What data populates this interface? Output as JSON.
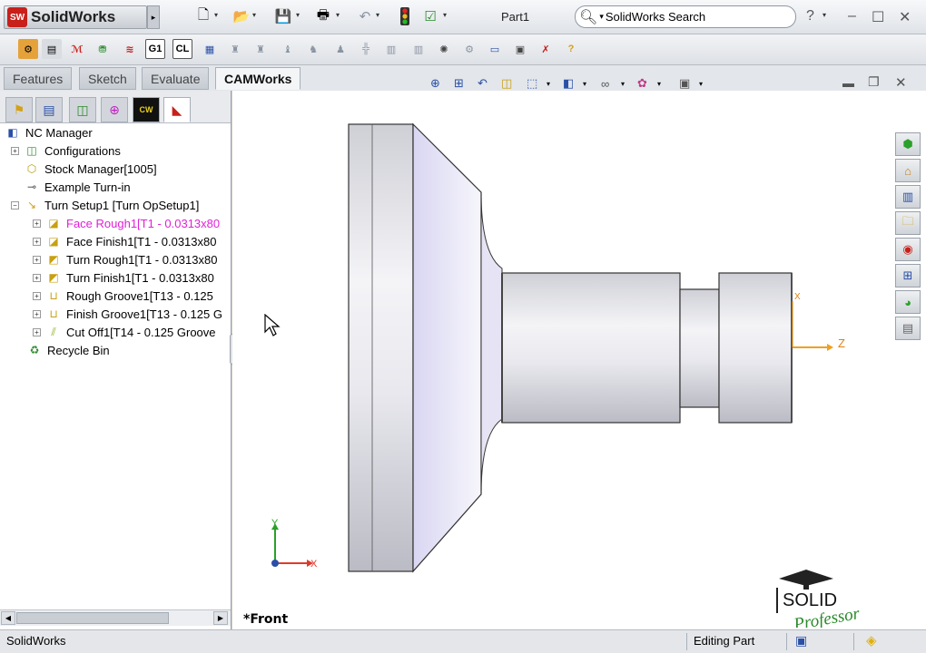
{
  "app": {
    "logo_badge": "SW",
    "name": "SolidWorks",
    "doc_title": "Part1"
  },
  "search": {
    "placeholder": "SolidWorks Search"
  },
  "window_buttons": [
    "?",
    "–",
    "☐",
    "✕"
  ],
  "top_tabs": [
    {
      "label": "Features"
    },
    {
      "label": "Sketch"
    },
    {
      "label": "Evaluate"
    },
    {
      "label": "CAMWorks",
      "active": true
    }
  ],
  "command_bar": {
    "labels": [
      "G1",
      "CL"
    ]
  },
  "tree": {
    "root": "NC Manager",
    "items": [
      {
        "label": "Configurations",
        "expander": "+"
      },
      {
        "label": "Stock Manager[1005]",
        "expander": ""
      },
      {
        "label": "Example Turn-in",
        "expander": ""
      },
      {
        "label": "Turn Setup1 [Turn OpSetup1]",
        "expander": "−"
      },
      {
        "label": "Face Rough1[T1 - 0.0313x80",
        "expander": "+",
        "highlight": true
      },
      {
        "label": "Face Finish1[T1 - 0.0313x80",
        "expander": "+"
      },
      {
        "label": "Turn Rough1[T1 - 0.0313x80",
        "expander": "+"
      },
      {
        "label": "Turn Finish1[T1 - 0.0313x80",
        "expander": "+"
      },
      {
        "label": "Rough Groove1[T13 - 0.125",
        "expander": "+"
      },
      {
        "label": "Finish Groove1[T13 - 0.125 G",
        "expander": "+"
      },
      {
        "label": "Cut Off1[T14 - 0.125 Groove",
        "expander": "+"
      },
      {
        "label": "Recycle Bin",
        "expander": ""
      }
    ]
  },
  "viewport": {
    "view_name": "*Front",
    "triad_axes": {
      "x": "X",
      "y": "Y",
      "z": "Z"
    }
  },
  "status": {
    "app": "SolidWorks",
    "mode": "Editing Part"
  },
  "brand": {
    "line1": "SOLID",
    "line2": "Professor"
  },
  "colors": {
    "highlight_text": "#e020d8",
    "axis_x": "#e03a2a",
    "axis_y": "#2aa02a",
    "axis_z": "#f0a020"
  }
}
